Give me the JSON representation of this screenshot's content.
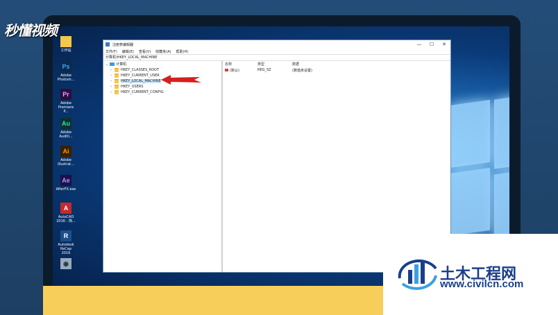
{
  "watermark": {
    "text": "秒懂视频"
  },
  "desktop_icons": [
    {
      "label": "工作站",
      "glyph": "",
      "bg": "#f2c94c",
      "fg": "#333"
    },
    {
      "label": "Adobe Photosh...",
      "glyph": "Ps",
      "bg": "#0b2a4a",
      "fg": "#31a8ff"
    },
    {
      "label": "Adobe Premiere P...",
      "glyph": "Pr",
      "bg": "#2a0f3f",
      "fg": "#e6a3ff"
    },
    {
      "label": "Adobe Auditi...",
      "glyph": "Au",
      "bg": "#0b3330",
      "fg": "#3ddbb7"
    },
    {
      "label": "Adobe Illustrat...",
      "glyph": "Ai",
      "bg": "#3a1f00",
      "fg": "#ff9a00"
    },
    {
      "label": "AfterFX.exe",
      "glyph": "Ae",
      "bg": "#20104a",
      "fg": "#9a9aff"
    },
    {
      "label": "AutoCAD 2016 - 简...",
      "glyph": "A",
      "bg": "#c7282e",
      "fg": "#fff"
    },
    {
      "label": "Autodesk ReCap 2016",
      "glyph": "R",
      "bg": "#1a4f8a",
      "fg": "#fff"
    },
    {
      "label": "",
      "glyph": "◉",
      "bg": "#9ab",
      "fg": "#234"
    }
  ],
  "window": {
    "title": "注册表编辑器",
    "controls": [
      "—",
      "☐",
      "✕"
    ],
    "menu": [
      "文件(F)",
      "编辑(E)",
      "查看(V)",
      "收藏夹(A)",
      "帮助(H)"
    ],
    "address": "计算机\\HKEY_LOCAL_MACHINE",
    "tree": {
      "root": "计算机",
      "items": [
        {
          "label": "HKEY_CLASSES_ROOT",
          "selected": false
        },
        {
          "label": "HKEY_CURRENT_USER",
          "selected": false
        },
        {
          "label": "HKEY_LOCAL_MACHINE",
          "selected": true
        },
        {
          "label": "HKEY_USERS",
          "selected": false
        },
        {
          "label": "HKEY_CURRENT_CONFIG",
          "selected": false
        }
      ]
    },
    "list": {
      "columns": [
        "名称",
        "类型",
        "数据"
      ],
      "rows": [
        {
          "name": "(默认)",
          "type": "REG_SZ",
          "data": "(数值未设置)"
        }
      ]
    }
  },
  "civil_logo": {
    "title": "土木工程网",
    "url": "www.civilcn.com",
    "brand_color": "#1b3e8a"
  },
  "colors": {
    "annotation_arrow": "#d81e1e",
    "yellow_bar": "#f8ce5a"
  }
}
